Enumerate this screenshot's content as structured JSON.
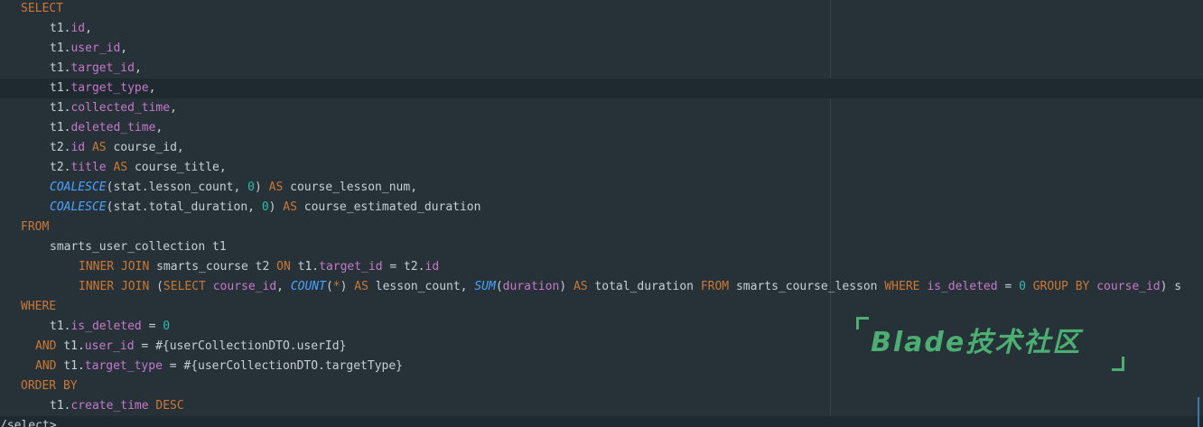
{
  "lines": [
    {
      "tokens": [
        {
          "t": "SELECT",
          "c": "kw"
        }
      ]
    },
    {
      "tokens": [
        {
          "t": "t1.",
          "c": "txt"
        },
        {
          "t": "id",
          "c": "fld"
        },
        {
          "t": ",",
          "c": "txt"
        }
      ]
    },
    {
      "tokens": [
        {
          "t": "t1.",
          "c": "txt"
        },
        {
          "t": "user_id",
          "c": "fld"
        },
        {
          "t": ",",
          "c": "txt"
        }
      ]
    },
    {
      "tokens": [
        {
          "t": "t1.",
          "c": "txt"
        },
        {
          "t": "target_id",
          "c": "fld"
        },
        {
          "t": ",",
          "c": "txt"
        }
      ]
    },
    {
      "tokens": [
        {
          "t": "t1.",
          "c": "txt"
        },
        {
          "t": "target_type",
          "c": "fld"
        },
        {
          "t": ",",
          "c": "txt"
        }
      ]
    },
    {
      "tokens": [
        {
          "t": "t1.",
          "c": "txt"
        },
        {
          "t": "collected_time",
          "c": "fld"
        },
        {
          "t": ",",
          "c": "txt"
        }
      ]
    },
    {
      "tokens": [
        {
          "t": "t1.",
          "c": "txt"
        },
        {
          "t": "deleted_time",
          "c": "fld"
        },
        {
          "t": ",",
          "c": "txt"
        }
      ]
    },
    {
      "tokens": [
        {
          "t": "t2.",
          "c": "txt"
        },
        {
          "t": "id",
          "c": "fld"
        },
        {
          "t": " AS ",
          "c": "kw"
        },
        {
          "t": "course_id,",
          "c": "txt"
        }
      ]
    },
    {
      "tokens": [
        {
          "t": "t2.",
          "c": "txt"
        },
        {
          "t": "title",
          "c": "fld"
        },
        {
          "t": " AS ",
          "c": "kw"
        },
        {
          "t": "course_title,",
          "c": "txt"
        }
      ]
    },
    {
      "tokens": [
        {
          "t": "COALESCE",
          "c": "fn"
        },
        {
          "t": "(stat.lesson_count, ",
          "c": "txt"
        },
        {
          "t": "0",
          "c": "num"
        },
        {
          "t": ") ",
          "c": "txt"
        },
        {
          "t": "AS ",
          "c": "kw"
        },
        {
          "t": "course_lesson_num,",
          "c": "txt"
        }
      ]
    },
    {
      "tokens": [
        {
          "t": "COALESCE",
          "c": "fn"
        },
        {
          "t": "(stat.total_duration, ",
          "c": "txt"
        },
        {
          "t": "0",
          "c": "num"
        },
        {
          "t": ") ",
          "c": "txt"
        },
        {
          "t": "AS ",
          "c": "kw"
        },
        {
          "t": "course_estimated_duration",
          "c": "txt"
        }
      ]
    },
    {
      "tokens": [
        {
          "t": "FROM",
          "c": "kw"
        }
      ]
    },
    {
      "tokens": [
        {
          "t": "smarts_user_collection t1",
          "c": "txt"
        }
      ]
    },
    {
      "tokens": [
        {
          "t": "INNER JOIN ",
          "c": "kw"
        },
        {
          "t": "smarts_course t2 ",
          "c": "txt"
        },
        {
          "t": "ON ",
          "c": "kw"
        },
        {
          "t": "t1.",
          "c": "txt"
        },
        {
          "t": "target_id",
          "c": "fld"
        },
        {
          "t": " = t2.",
          "c": "txt"
        },
        {
          "t": "id",
          "c": "fld"
        }
      ]
    },
    {
      "tokens": [
        {
          "t": "INNER JOIN ",
          "c": "kw"
        },
        {
          "t": "(",
          "c": "txt"
        },
        {
          "t": "SELECT ",
          "c": "kw"
        },
        {
          "t": "course_id",
          "c": "fld"
        },
        {
          "t": ", ",
          "c": "txt"
        },
        {
          "t": "COUNT",
          "c": "fn"
        },
        {
          "t": "(",
          "c": "txt"
        },
        {
          "t": "*",
          "c": "kw"
        },
        {
          "t": ") ",
          "c": "txt"
        },
        {
          "t": "AS ",
          "c": "kw"
        },
        {
          "t": "lesson_count, ",
          "c": "txt"
        },
        {
          "t": "SUM",
          "c": "fn"
        },
        {
          "t": "(",
          "c": "txt"
        },
        {
          "t": "duration",
          "c": "fld"
        },
        {
          "t": ") ",
          "c": "txt"
        },
        {
          "t": "AS ",
          "c": "kw"
        },
        {
          "t": "total_duration ",
          "c": "txt"
        },
        {
          "t": "FROM ",
          "c": "kw"
        },
        {
          "t": "smarts_course_lesson ",
          "c": "txt"
        },
        {
          "t": "WHERE ",
          "c": "kw"
        },
        {
          "t": "is_deleted",
          "c": "fld"
        },
        {
          "t": " = ",
          "c": "txt"
        },
        {
          "t": "0",
          "c": "num"
        },
        {
          "t": " GROUP BY ",
          "c": "kw"
        },
        {
          "t": "course_id",
          "c": "fld"
        },
        {
          "t": ") s",
          "c": "txt"
        }
      ]
    },
    {
      "tokens": [
        {
          "t": "WHERE",
          "c": "kw"
        }
      ]
    },
    {
      "tokens": [
        {
          "t": "t1.",
          "c": "txt"
        },
        {
          "t": "is_deleted",
          "c": "fld"
        },
        {
          "t": " = ",
          "c": "txt"
        },
        {
          "t": "0",
          "c": "num"
        }
      ]
    },
    {
      "tokens": [
        {
          "t": "AND ",
          "c": "kw"
        },
        {
          "t": "t1.",
          "c": "txt"
        },
        {
          "t": "user_id",
          "c": "fld"
        },
        {
          "t": " = #{userCollectionDTO.userId}",
          "c": "txt"
        }
      ]
    },
    {
      "tokens": [
        {
          "t": "AND ",
          "c": "kw"
        },
        {
          "t": "t1.",
          "c": "txt"
        },
        {
          "t": "target_type",
          "c": "fld"
        },
        {
          "t": " = #{userCollectionDTO.targetType}",
          "c": "txt"
        }
      ]
    },
    {
      "tokens": [
        {
          "t": "ORDER BY",
          "c": "kw"
        }
      ]
    },
    {
      "tokens": [
        {
          "t": "t1.",
          "c": "txt"
        },
        {
          "t": "create_time",
          "c": "fld"
        },
        {
          "t": " DESC",
          "c": "kw"
        }
      ]
    },
    {
      "tokens": [
        {
          "t": "/select>",
          "c": "txt"
        }
      ]
    }
  ],
  "watermark": {
    "text": "Blade技术社区"
  },
  "colors": {
    "background": "#263238",
    "keyword": "#cc7832",
    "field": "#c678c9",
    "function": "#4aa3ff",
    "number": "#2bbbad",
    "plain": "#c7cfd6",
    "watermark": "#4caf72"
  }
}
